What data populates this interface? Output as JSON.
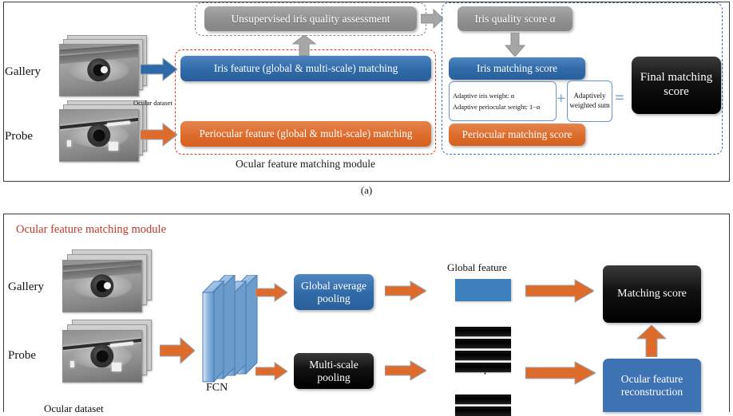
{
  "figure": {
    "caption_a": "(a)"
  },
  "panel_a": {
    "module_label": "Ocular feature matching module",
    "quality_assessment": "Unsupervised iris quality assessment",
    "quality_score": "Iris quality score α",
    "iris_feature_matching": "Iris feature (global & multi-scale) matching",
    "periocular_feature_matching": "Periocular feature (global & multi-scale) matching",
    "iris_matching_score": "Iris matching score",
    "periocular_matching_score": "Periocular matching score",
    "adaptive_iris_weight": "Adaptive iris weight: α",
    "adaptive_periocular_weight": "Adaptive periocular weight: 1−α",
    "adaptively_weighted_sum": "Adaptively weighted sum",
    "plus_symbol": "+",
    "equals_symbol": "=",
    "final_matching_score": "Final matching score",
    "gallery_label": "Gallery",
    "probe_label": "Probe",
    "ocular_dataset": "Ocular dataset"
  },
  "panel_b": {
    "module_label": "Ocular feature matching module",
    "gallery_label": "Gallery",
    "probe_label": "Probe",
    "ocular_dataset": "Ocular dataset",
    "fcn_label": "FCN",
    "global_average_pooling": "Global average pooling",
    "multi_scale_pooling": "Multi-scale pooling",
    "global_feature_label": "Global feature",
    "matching_score": "Matching score",
    "ocular_feature_reconstruction": "Ocular feature reconstruction",
    "vertical_dots": "⋮"
  },
  "colors": {
    "blue": "#2f6aa8",
    "orange": "#dd6c2c",
    "gray": "#909090",
    "black": "#000000",
    "red_dashed": "#e23b2e",
    "blue_dashed": "#3f74c4",
    "gray_dashed": "#8d8d8d",
    "module_label_red": "#c0392b"
  }
}
